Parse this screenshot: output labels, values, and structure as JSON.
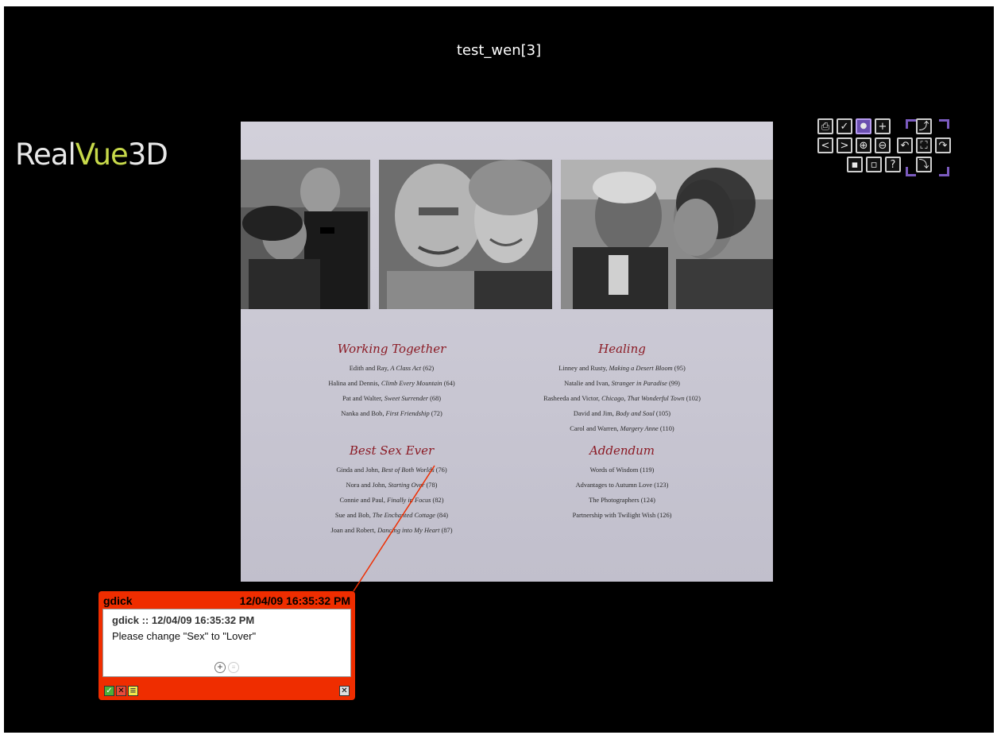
{
  "window": {
    "title": "test_wen[3]"
  },
  "logo": {
    "part1": "Real",
    "part2": "Vue",
    "part3": "3D"
  },
  "toolbar": {
    "buttons": [
      {
        "name": "print-button",
        "icon": "printer-icon",
        "glyph": "⎙"
      },
      {
        "name": "approve-button",
        "icon": "checkmark-icon",
        "glyph": "✓"
      },
      {
        "name": "comment-button",
        "icon": "speech-bubble-icon",
        "glyph": "💬"
      },
      {
        "name": "add-comment-button",
        "icon": "speech-bubble-plus-icon",
        "glyph": "+"
      },
      {
        "name": "prev-page-button",
        "icon": "chevron-left-icon",
        "glyph": "<"
      },
      {
        "name": "next-page-button",
        "icon": "chevron-right-icon",
        "glyph": ">"
      },
      {
        "name": "zoom-in-button",
        "icon": "zoom-in-icon",
        "glyph": "⊕"
      },
      {
        "name": "zoom-out-button",
        "icon": "zoom-out-icon",
        "glyph": "⊖"
      },
      {
        "name": "thumbnails-button",
        "icon": "thumbnails-icon",
        "glyph": "▪"
      },
      {
        "name": "layout-button",
        "icon": "layout-icon",
        "glyph": "▫"
      },
      {
        "name": "help-button",
        "icon": "help-icon",
        "glyph": "?"
      },
      {
        "name": "rotate-up-button",
        "icon": "rotate-up-icon",
        "glyph": "⤴"
      },
      {
        "name": "rotate-left-button",
        "icon": "rotate-left-icon",
        "glyph": "↶"
      },
      {
        "name": "fit-screen-button",
        "icon": "fullscreen-icon",
        "glyph": "⛶"
      },
      {
        "name": "rotate-right-button",
        "icon": "rotate-right-icon",
        "glyph": "↷"
      },
      {
        "name": "rotate-down-button",
        "icon": "rotate-down-icon",
        "glyph": "⤵"
      }
    ]
  },
  "page": {
    "sections": [
      {
        "heading": "Working Together",
        "entries": [
          {
            "names": "Edith and Ray, ",
            "title": "A Class Act",
            "pageno": "(62)"
          },
          {
            "names": "Halina and Dennis, ",
            "title": "Climb Every Mountain",
            "pageno": "(64)"
          },
          {
            "names": "Pat and Walter, ",
            "title": "Sweet Surrender",
            "pageno": "(68)"
          },
          {
            "names": "Nanka and Bob, ",
            "title": "First Friendship",
            "pageno": "(72)"
          }
        ]
      },
      {
        "heading": "Healing",
        "entries": [
          {
            "names": "Linney and Rusty, ",
            "title": "Making a Desert Bloom",
            "pageno": "(95)"
          },
          {
            "names": "Natalie and Ivan, ",
            "title": "Stranger in Paradise",
            "pageno": "(99)"
          },
          {
            "names": "Rasheeda and Victor, ",
            "title": "Chicago, That Wonderful Town",
            "pageno": "(102)"
          },
          {
            "names": "David and Jim, ",
            "title": "Body and Soul",
            "pageno": "(105)"
          },
          {
            "names": "Carol and Warren, ",
            "title": "Margery Anne",
            "pageno": "(110)"
          }
        ]
      },
      {
        "heading": "Best Sex Ever",
        "entries": [
          {
            "names": "Ginda and John, ",
            "title": "Best of Both Worlds",
            "pageno": "(76)"
          },
          {
            "names": "Nora and John, ",
            "title": "Starting Over",
            "pageno": "(78)"
          },
          {
            "names": "Connie and Paul, ",
            "title": "Finally in Focus",
            "pageno": "(82)"
          },
          {
            "names": "Sue and Bob, ",
            "title": "The Enchanted Cottage",
            "pageno": "(84)"
          },
          {
            "names": "Joan and Robert, ",
            "title": "Dancing into My Heart",
            "pageno": "(87)"
          }
        ]
      },
      {
        "heading": "Addendum",
        "entries": [
          {
            "names": "Words of Wisdom ",
            "title": "",
            "pageno": "(119)"
          },
          {
            "names": "Advantages to Autumn Love ",
            "title": "",
            "pageno": "(123)"
          },
          {
            "names": "The Photographers ",
            "title": "",
            "pageno": "(124)"
          },
          {
            "names": "Partnership with Twilight Wish ",
            "title": "",
            "pageno": "(126)"
          }
        ]
      }
    ]
  },
  "note": {
    "author": "gdick",
    "timestamp": "12/04/09 16:35:32 PM",
    "meta": "gdick :: 12/04/09 16:35:32 PM",
    "text": "Please change \"Sex\" to \"Lover\"",
    "add_reply_glyph": "+",
    "list_glyph": "≡",
    "approve_glyph": "✓",
    "reject_glyph": "✕",
    "memo_glyph": "≡",
    "close_glyph": "✕"
  },
  "colors": {
    "background": "#000000",
    "note_red": "#ef2d00",
    "heading_red": "#8b1a24",
    "toolbar_purple": "#7b5bbf",
    "logo_green": "#c7d94a"
  }
}
